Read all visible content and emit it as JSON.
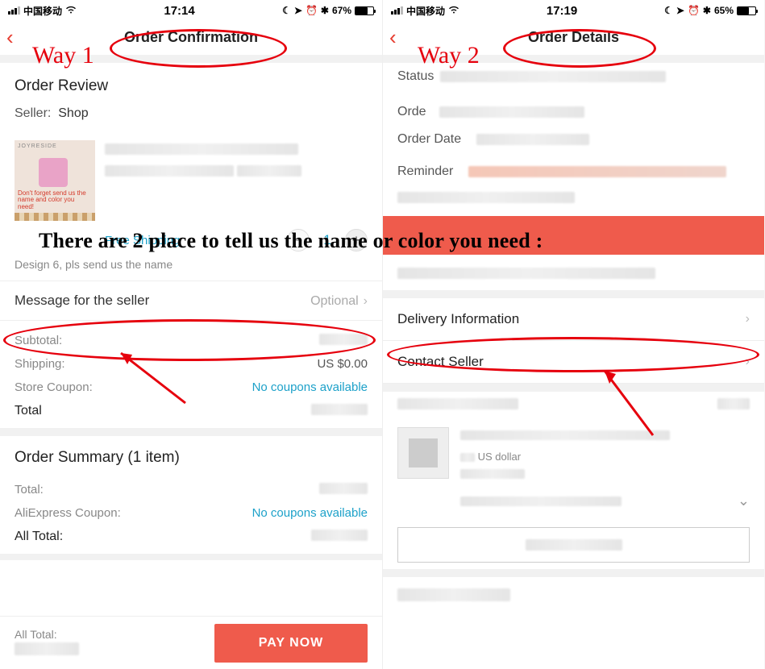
{
  "overlay": "There are 2 place to tell us the name or color you need :",
  "annotations": {
    "way1": "Way 1",
    "way2": "Way 2"
  },
  "phone1": {
    "status": {
      "carrier": "中国移动",
      "time": "17:14",
      "battery_pct": "67%"
    },
    "nav": {
      "title": "Order Confirmation"
    },
    "review_title": "Order Review",
    "seller_label": "Seller:",
    "seller_name": "Shop",
    "thumb": {
      "brand": "JOYRESIDE",
      "note": "Don't forget send us the name and color you need!"
    },
    "free_shipping": "Free Shipping",
    "qty": "1",
    "variant_note": "Design 6, pls send us the name",
    "msg": {
      "label": "Message for the seller",
      "hint": "Optional"
    },
    "prices": {
      "subtotal_l": "Subtotal:",
      "shipping_l": "Shipping:",
      "shipping_v": "US $0.00",
      "coupon_l": "Store Coupon:",
      "coupon_v": "No coupons available",
      "total_l": "Total"
    },
    "summary": {
      "title": "Order Summary (1 item)",
      "total_l": "Total:",
      "ae_coupon_l": "AliExpress Coupon:",
      "ae_coupon_v": "No coupons available",
      "all_total_l": "All Total:"
    },
    "paybar": {
      "all_total_l": "All Total:",
      "button": "PAY NOW"
    }
  },
  "phone2": {
    "status": {
      "carrier": "中国移动",
      "time": "17:19",
      "battery_pct": "65%"
    },
    "nav": {
      "title": "Order Details"
    },
    "fields": {
      "status": "Status",
      "order": "Orde",
      "order_date": "Order Date",
      "reminder": "Reminder"
    },
    "rows": {
      "delivery": "Delivery Information",
      "contact": "Contact Seller"
    },
    "currency_hint": "US dollar",
    "expand_icon": "⌄"
  }
}
